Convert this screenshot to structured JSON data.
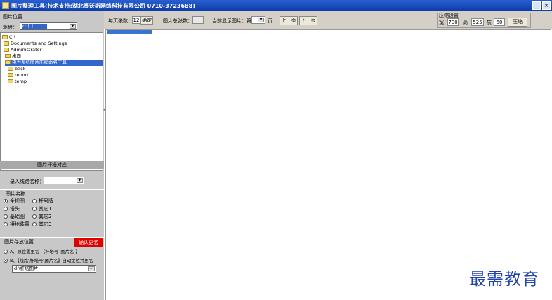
{
  "window": {
    "title": "图片整理工具(技术支持:湖北赛沃斯网络科技有限公司 0710-3723688)",
    "min_icon": "minimize-icon",
    "close_icon": "close-icon"
  },
  "left": {
    "location_group": "图片位置",
    "drive_label": "驱盘：",
    "drive_value": "c: [ ]",
    "tree": [
      {
        "label": "C:\\",
        "level": 0
      },
      {
        "label": "Documents and Settings",
        "level": 1
      },
      {
        "label": "Administrator",
        "level": 1
      },
      {
        "label": "桌面",
        "level": 2
      },
      {
        "label": "电力系统图片压缩命名工具",
        "level": 2,
        "selected": true
      },
      {
        "label": "back",
        "level": 3
      },
      {
        "label": "report",
        "level": 3
      },
      {
        "label": "temp",
        "level": 3
      }
    ],
    "tower_section": "图片杆塔对应",
    "line_name_label": "录入线路名称：",
    "line_name_value": "",
    "name_group": "图片名称",
    "name_options": [
      {
        "label": "全视图",
        "checked": true
      },
      {
        "label": "杆号牌",
        "checked": false
      },
      {
        "label": "塔头",
        "checked": false
      },
      {
        "label": "其它1",
        "checked": false
      },
      {
        "label": "基础图",
        "checked": false
      },
      {
        "label": "其它2",
        "checked": false
      },
      {
        "label": "接地装置",
        "checked": false
      },
      {
        "label": "其它3",
        "checked": false
      }
    ],
    "storage_group": "图片存放位置",
    "confirm_rename": "确认更名",
    "storage_options": [
      {
        "label": "A、原位置更名 【杆塔号_图片名 】",
        "checked": false
      },
      {
        "label": "B、【线路\\杆塔号\\图片名】自动定位并更名",
        "checked": true
      }
    ],
    "storage_path": "d:\\杆塔图片"
  },
  "toolbar": {
    "per_page_label": "每页张数：",
    "per_page_value": "12",
    "confirm_btn": "确定",
    "total_label": "图片总张数：",
    "total_value": "",
    "current_label": "当前显示图片：第",
    "current_value": "",
    "page_suffix": "页",
    "prev_btn": "上一页",
    "next_btn": "下一页",
    "compress_group": "压缩设置",
    "width_label": "宽：",
    "width_value": "700",
    "height_label": "高",
    "height_value": "525",
    "quality_label": "质",
    "quality_value": "60",
    "compress_btn": "压缩"
  },
  "watermark": "最需教育",
  "colors": {
    "titlebar": "#0a3aa8",
    "selection": "#3366cc",
    "confirm_rename_bg": "#e00000",
    "progress": "#3a73d0",
    "watermark": "#2244aa"
  }
}
